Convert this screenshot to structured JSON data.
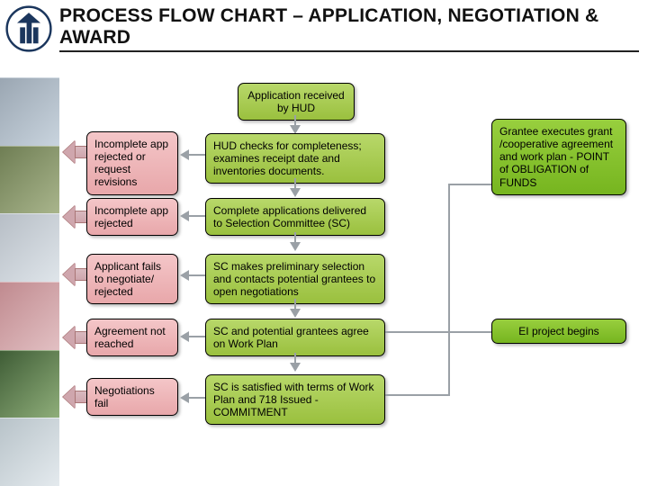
{
  "header": {
    "title": "PROCESS FLOW CHART – APPLICATION, NEGOTIATION & AWARD"
  },
  "flow": {
    "start": "Application received by HUD",
    "steps": [
      {
        "main": "HUD checks for completeness; examines receipt date and inventories documents.",
        "reject": "Incomplete app rejected or request revisions"
      },
      {
        "main": "Complete applications delivered to Selection Committee (SC)",
        "reject": "Incomplete app rejected"
      },
      {
        "main": "SC makes preliminary selection and contacts potential grantees to open negotiations",
        "reject": "Applicant fails to negotiate/ rejected"
      },
      {
        "main": "SC and potential grantees agree on Work Plan",
        "reject": "Agreement not reached"
      },
      {
        "main": "SC is satisfied with terms of Work Plan and 718 Issued - COMMITMENT",
        "reject": "Negotiations fail"
      }
    ],
    "right": {
      "top": "Grantee executes grant /cooperative agreement and work plan - POINT of OBLIGATION of FUNDS",
      "bottom": "EI project begins"
    }
  }
}
